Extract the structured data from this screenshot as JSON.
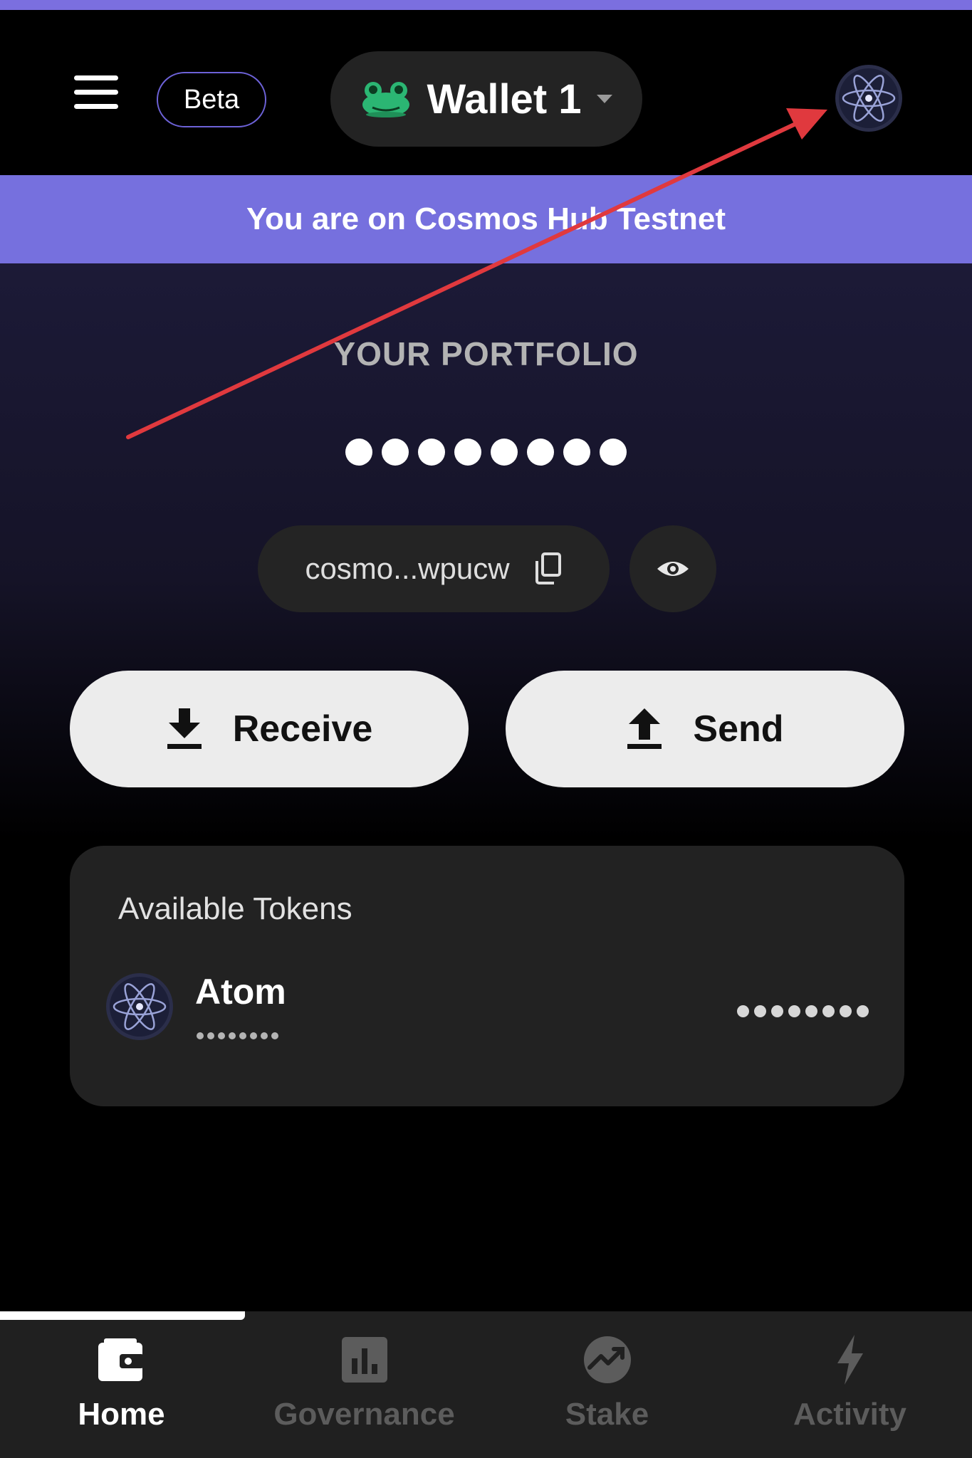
{
  "header": {
    "beta_label": "Beta",
    "wallet_name": "Wallet 1"
  },
  "banner": {
    "network_text": "You are on Cosmos Hub Testnet"
  },
  "portfolio": {
    "title": "YOUR PORTFOLIO",
    "address": "cosmo...wpucw"
  },
  "actions": {
    "receive_label": "Receive",
    "send_label": "Send"
  },
  "tokens": {
    "title": "Available Tokens",
    "items": [
      {
        "name": "Atom"
      }
    ]
  },
  "nav": {
    "items": [
      {
        "label": "Home",
        "active": true
      },
      {
        "label": "Governance",
        "active": false
      },
      {
        "label": "Stake",
        "active": false
      },
      {
        "label": "Activity",
        "active": false
      }
    ]
  },
  "colors": {
    "accent": "#7670de",
    "top_strip": "#7b6fdf",
    "annotation": "#e0393e",
    "nav_inactive": "#5c5c5c"
  }
}
